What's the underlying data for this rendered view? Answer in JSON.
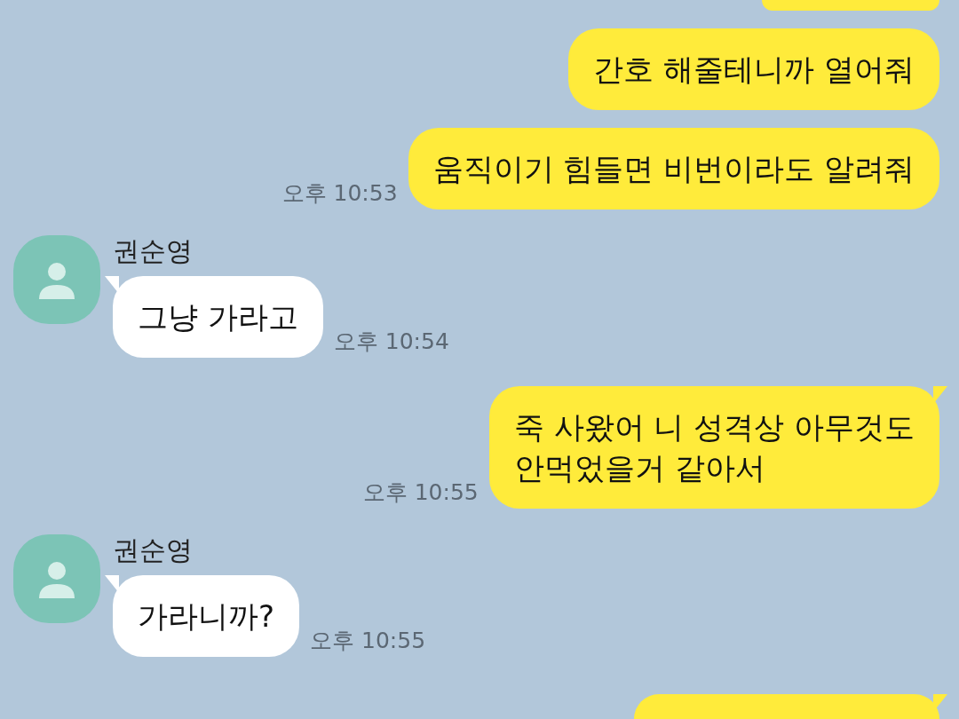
{
  "messages": [
    {
      "kind": "cut-top"
    },
    {
      "kind": "sent",
      "text": "간호 해줄테니까 열어줘",
      "tail": false
    },
    {
      "kind": "sent",
      "text": "움직이기 힘들면 비번이라도 알려줘",
      "time": "오후 10:53",
      "tail": false
    },
    {
      "kind": "received",
      "name": "권순영",
      "text": "그냥 가라고",
      "time": "오후 10:54",
      "tail": true
    },
    {
      "kind": "sent",
      "text": "죽 사왔어 니 성격상 아무것도\n안먹었을거 같아서",
      "time": "오후 10:55",
      "tail": true
    },
    {
      "kind": "received",
      "name": "권순영",
      "text": "가라니까?",
      "time": "오후 10:55",
      "tail": true
    },
    {
      "kind": "cut-bottom",
      "tail": true
    }
  ]
}
